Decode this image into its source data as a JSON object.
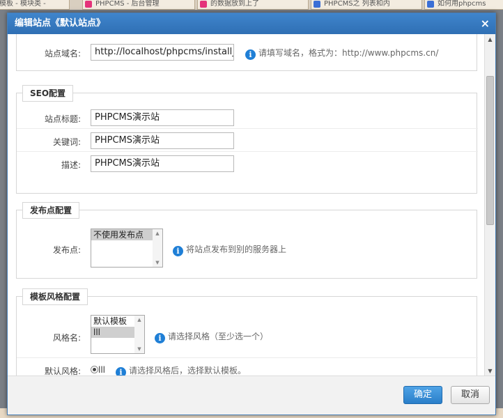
{
  "browser_tabs": [
    {
      "label": "模板 - 模块类 -",
      "color": "#d9534f"
    },
    {
      "label": "PHPCMS - 后台管理",
      "color": "#e4337a"
    },
    {
      "label": "的数据放到上了",
      "color": "#e4337a"
    },
    {
      "label": "PHPCMS之 列表和内",
      "color": "#3b6fd6"
    },
    {
      "label": "如何用phpcms",
      "color": "#3b6fd6"
    }
  ],
  "dialog": {
    "title": "编辑站点《默认站点》",
    "close_symbol": "×"
  },
  "domain_row": {
    "label": "站点域名:",
    "value": "http://localhost/phpcms/install_",
    "hint": "请填写域名，格式为：http://www.phpcms.cn/"
  },
  "seo": {
    "legend": "SEO配置",
    "title_label": "站点标题:",
    "title_value": "PHPCMS演示站",
    "keywords_label": "关键词:",
    "keywords_value": "PHPCMS演示站",
    "desc_label": "描述:",
    "desc_value": "PHPCMS演示站"
  },
  "publish": {
    "legend": "发布点配置",
    "label": "发布点:",
    "options": [
      "不使用发布点"
    ],
    "hint": "将站点发布到别的服务器上"
  },
  "template": {
    "legend": "模板风格配置",
    "style_label": "风格名:",
    "style_options": [
      "默认模板",
      "lll"
    ],
    "style_hint": "请选择风格（至少选一个）",
    "default_label": "默认风格:",
    "default_value": "lll",
    "default_hint": "请选择风格后，选择默认模板。"
  },
  "footer": {
    "ok": "确定",
    "cancel": "取消"
  },
  "icons": {
    "info": "i",
    "scroll_up": "▲",
    "scroll_down": "▼"
  },
  "colors": {
    "title_bar": "#2f6fb4",
    "info_icon": "#1f7fd6",
    "ok_button": "#2a7fc9"
  }
}
